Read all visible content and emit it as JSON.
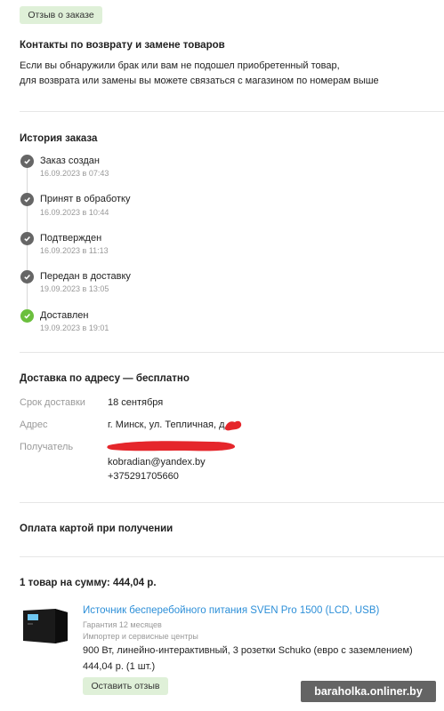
{
  "top_button": "Отзыв о заказе",
  "returns": {
    "title": "Контакты по возврату и замене товаров",
    "line1": "Если вы обнаружили брак или вам не подошел приобретенный товар,",
    "line2": "для возврата или замены вы можете связаться с магазином по номерам выше"
  },
  "history": {
    "title": "История заказа",
    "items": [
      {
        "label": "Заказ создан",
        "time": "16.09.2023 в 07:43",
        "icon": "check-icon"
      },
      {
        "label": "Принят в обработку",
        "time": "16.09.2023 в 10:44",
        "icon": "check-icon"
      },
      {
        "label": "Подтвержден",
        "time": "16.09.2023 в 11:13",
        "icon": "check-icon"
      },
      {
        "label": "Передан в доставку",
        "time": "19.09.2023 в 13:05",
        "icon": "check-icon"
      },
      {
        "label": "Доставлен",
        "time": "19.09.2023 в 19:01",
        "icon": "check-icon"
      }
    ]
  },
  "delivery": {
    "title": "Доставка по адресу — бесплатно",
    "term_label": "Срок доставки",
    "term_value": "18 сентября",
    "address_label": "Адрес",
    "address_value": "г. Минск, ул. Тепличная, д.",
    "recipient_label": "Получатель",
    "email": "kobradian@yandex.by",
    "phone": "+375291705660"
  },
  "payment": {
    "title": "Оплата картой при получении"
  },
  "order": {
    "summary": "1 товар на сумму: 444,04 р.",
    "product": {
      "name": "Источник бесперебойного питания SVEN Pro 1500 (LCD, USB)",
      "warranty": "Гарантия 12 месяцев",
      "importer": "Импортер и сервисные центры",
      "description": "900 Вт, линейно-интерактивный, 3 розетки Schuko (евро с заземлением)",
      "price": "444,04 р. (1 шт.)",
      "review_button": "Оставить отзыв"
    }
  },
  "watermark": "baraholka.onliner.by",
  "colors": {
    "accent_green": "#6bbf3d",
    "button_green_bg": "#dff0d8",
    "link_blue": "#2d8fd8",
    "redaction_red": "#e5262b"
  }
}
